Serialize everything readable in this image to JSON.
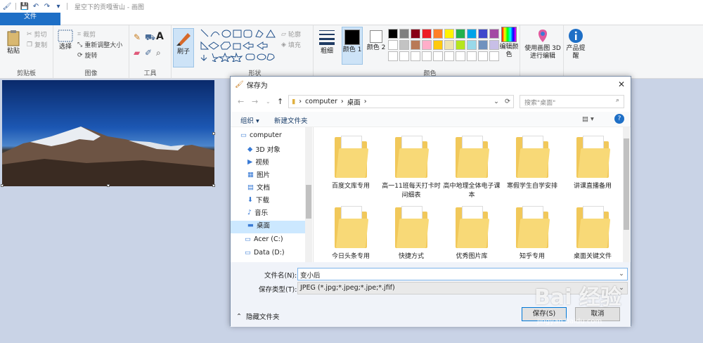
{
  "window": {
    "title": "星空下的贡嘎雪山 - 画图",
    "quick_access": [
      "save-icon",
      "undo-icon",
      "redo-icon",
      "customize-icon"
    ]
  },
  "tabs": [
    {
      "label": "文件"
    },
    {
      "label": "主页"
    },
    {
      "label": "查看"
    }
  ],
  "ribbon": {
    "clipboard": {
      "paste": "粘贴",
      "cut": "剪切",
      "copy": "复制",
      "group": "剪贴板"
    },
    "image": {
      "select": "选择",
      "crop": "裁剪",
      "resize": "重新调整大小",
      "rotate": "旋转",
      "group": "图像"
    },
    "tools": {
      "group": "工具"
    },
    "brushes": {
      "label": "刷子"
    },
    "shapes": {
      "outline": "轮廓",
      "fill": "填充",
      "group": "形状"
    },
    "size": {
      "label": "粗细"
    },
    "colors": {
      "color1": "颜色 1",
      "color2": "颜色 2",
      "edit": "编辑颜色",
      "group": "颜色",
      "palette_row1": [
        "#000000",
        "#7f7f7f",
        "#880015",
        "#ed1c24",
        "#ff7f27",
        "#fff200",
        "#22b14c",
        "#00a2e8",
        "#3f48cc",
        "#a349a4"
      ],
      "palette_row2": [
        "#ffffff",
        "#c3c3c3",
        "#b97a57",
        "#ffaec9",
        "#ffc90e",
        "#efe4b0",
        "#b5e61d",
        "#99d9ea",
        "#7092be",
        "#c8bfe7"
      ]
    },
    "paint3d": "使用画图 3D 进行编辑",
    "product_alert": "产品提醒"
  },
  "dialog": {
    "title": "保存为",
    "breadcrumb": [
      "computer",
      "桌面"
    ],
    "search_placeholder": "搜索\"桌面\"",
    "organize": "组织",
    "new_folder": "新建文件夹",
    "tree": [
      {
        "label": "computer"
      },
      {
        "label": "3D 对象"
      },
      {
        "label": "视频"
      },
      {
        "label": "图片"
      },
      {
        "label": "文档"
      },
      {
        "label": "下载"
      },
      {
        "label": "音乐"
      },
      {
        "label": "桌面"
      },
      {
        "label": "Acer (C:)"
      },
      {
        "label": "Data (D:)"
      }
    ],
    "files": [
      {
        "label": "百度文库专用"
      },
      {
        "label": "高一11班每天打卡时间细表"
      },
      {
        "label": "高中地理全体电子课本"
      },
      {
        "label": "寒假学生自学安排"
      },
      {
        "label": "讲课直播备用"
      },
      {
        "label": "今日头条专用"
      },
      {
        "label": "快捷方式"
      },
      {
        "label": "优秀图片库"
      },
      {
        "label": "知乎专用"
      },
      {
        "label": "桌面关键文件"
      }
    ],
    "filename_label": "文件名(N):",
    "filename_value": "变小后",
    "filetype_label": "保存类型(T):",
    "filetype_value": "JPEG (*.jpg;*.jpeg;*.jpe;*.jfif)",
    "hide_folders": "隐藏文件夹",
    "save_button": "保存(S)",
    "cancel_button": "取消"
  },
  "watermark": {
    "brand": "Bai 经验",
    "url": "jingyan.baidu.com"
  }
}
